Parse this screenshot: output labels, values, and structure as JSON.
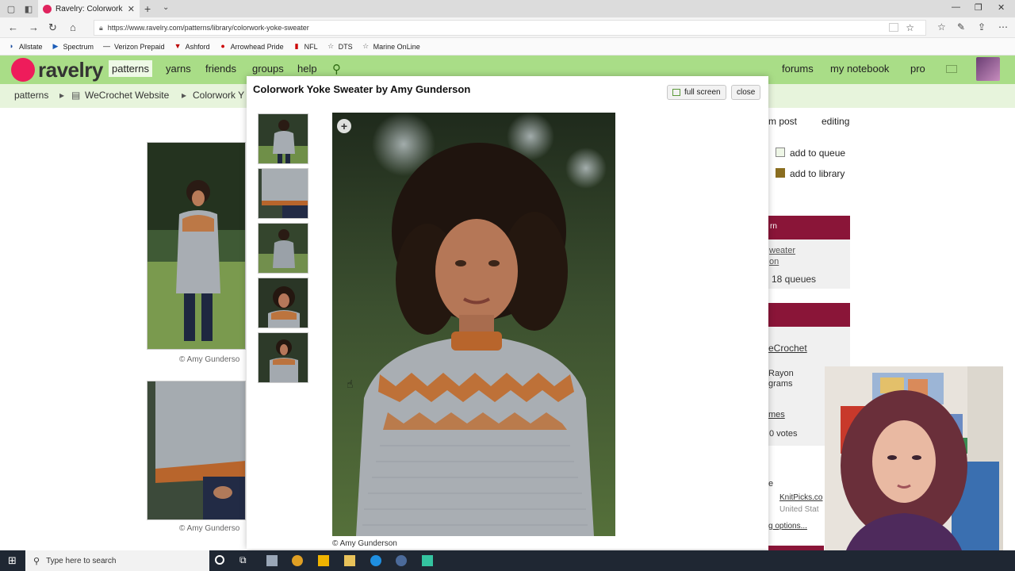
{
  "browser": {
    "tab_title": "Ravelry: Colorwork Yoke",
    "url": "https://www.ravelry.com/patterns/library/colorwork-yoke-sweater",
    "favorites": [
      "Allstate",
      "Spectrum",
      "Verizon Prepaid",
      "Ashford",
      "Arrowhead Pride",
      "NFL",
      "DTS",
      "Marine OnLine"
    ]
  },
  "header": {
    "logo": "ravelry",
    "nav": [
      "patterns",
      "yarns",
      "friends",
      "groups",
      "help"
    ],
    "right_nav": [
      "forums",
      "my notebook",
      "pro"
    ]
  },
  "breadcrumb": {
    "items": [
      "patterns",
      "WeCrochet Website",
      "Colorwork Y"
    ]
  },
  "page": {
    "image_caption": "© Amy Gunderso",
    "tabs_fragment": [
      "m post",
      "editing"
    ],
    "actions": [
      "add to queue",
      "add to library"
    ],
    "panel1": {
      "header": "rn",
      "link1": "weater",
      "link2": "on",
      "queues": "18 queues"
    },
    "panel2": {
      "link": "eCrochet",
      "line1": "Rayon",
      "line2": "grams",
      "link2": "mes",
      "votes": "0 votes"
    },
    "panel3": {
      "frag": "e",
      "link": "KnitPicks.co",
      "sub": "United Stat",
      "options": "g options..."
    }
  },
  "modal": {
    "title": "Colorwork Yoke Sweater by Amy Gunderson",
    "full_screen": "full screen",
    "close": "close",
    "photo_caption": "© Amy Gunderson",
    "plus": "+"
  },
  "taskbar": {
    "search_placeholder": "Type here to search"
  },
  "colors": {
    "header_green": "#a9dd87",
    "subbar_green": "#e7f4dc",
    "brand_red": "#ee1c5b",
    "panel_maroon": "#8a1538"
  }
}
